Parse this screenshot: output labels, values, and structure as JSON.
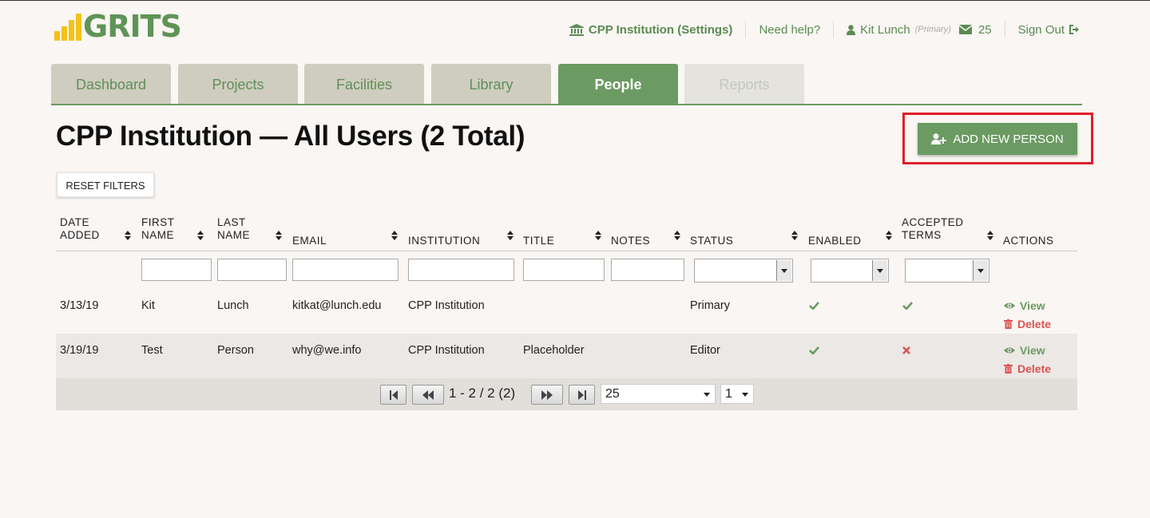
{
  "brand": {
    "name": "GRITS",
    "bar_color": "#f2c21b",
    "text_color": "#5f9457"
  },
  "topnav": {
    "institution_label": "CPP Institution (Settings)",
    "help_label": "Need help?",
    "user_name": "Kit Lunch",
    "user_role": "(Primary)",
    "message_count": "25",
    "signout_label": "Sign Out"
  },
  "tabs": [
    {
      "label": "Dashboard",
      "state": "normal"
    },
    {
      "label": "Projects",
      "state": "normal"
    },
    {
      "label": "Facilities",
      "state": "normal"
    },
    {
      "label": "Library",
      "state": "normal"
    },
    {
      "label": "People",
      "state": "active"
    },
    {
      "label": "Reports",
      "state": "disabled"
    }
  ],
  "page": {
    "title": "CPP Institution — All Users (2 Total)",
    "add_button_label": "ADD NEW PERSON",
    "reset_filters_label": "RESET FILTERS"
  },
  "table": {
    "columns": [
      {
        "line1": "DATE",
        "line2": "ADDED"
      },
      {
        "line1": "FIRST",
        "line2": "NAME"
      },
      {
        "line1": "LAST",
        "line2": "NAME"
      },
      {
        "line1": "",
        "line2": "EMAIL"
      },
      {
        "line1": "",
        "line2": "INSTITUTION"
      },
      {
        "line1": "",
        "line2": "TITLE"
      },
      {
        "line1": "",
        "line2": "NOTES"
      },
      {
        "line1": "",
        "line2": "STATUS"
      },
      {
        "line1": "",
        "line2": "ENABLED"
      },
      {
        "line1": "ACCEPTED",
        "line2": "TERMS"
      },
      {
        "line1": "",
        "line2": "ACTIONS"
      }
    ],
    "rows": [
      {
        "date_added": "3/13/19",
        "first_name": "Kit",
        "last_name": "Lunch",
        "email": "kitkat@lunch.edu",
        "institution": "CPP Institution",
        "title": "",
        "notes": "",
        "status": "Primary",
        "enabled": "check",
        "accepted_terms": "check"
      },
      {
        "date_added": "3/19/19",
        "first_name": "Test",
        "last_name": "Person",
        "email": "why@we.info",
        "institution": "CPP Institution",
        "title": "Placeholder",
        "notes": "",
        "status": "Editor",
        "enabled": "check",
        "accepted_terms": "cross"
      }
    ],
    "actions": {
      "view_label": "View",
      "delete_label": "Delete"
    }
  },
  "pager": {
    "info": "1 - 2 / 2 (2)",
    "page_size": "25",
    "page_number": "1"
  },
  "colors": {
    "accent_green": "#6b9a62",
    "delete_red": "#d9534f",
    "highlight_red": "#e01e2b",
    "tab_bg": "#cfcdbf"
  }
}
